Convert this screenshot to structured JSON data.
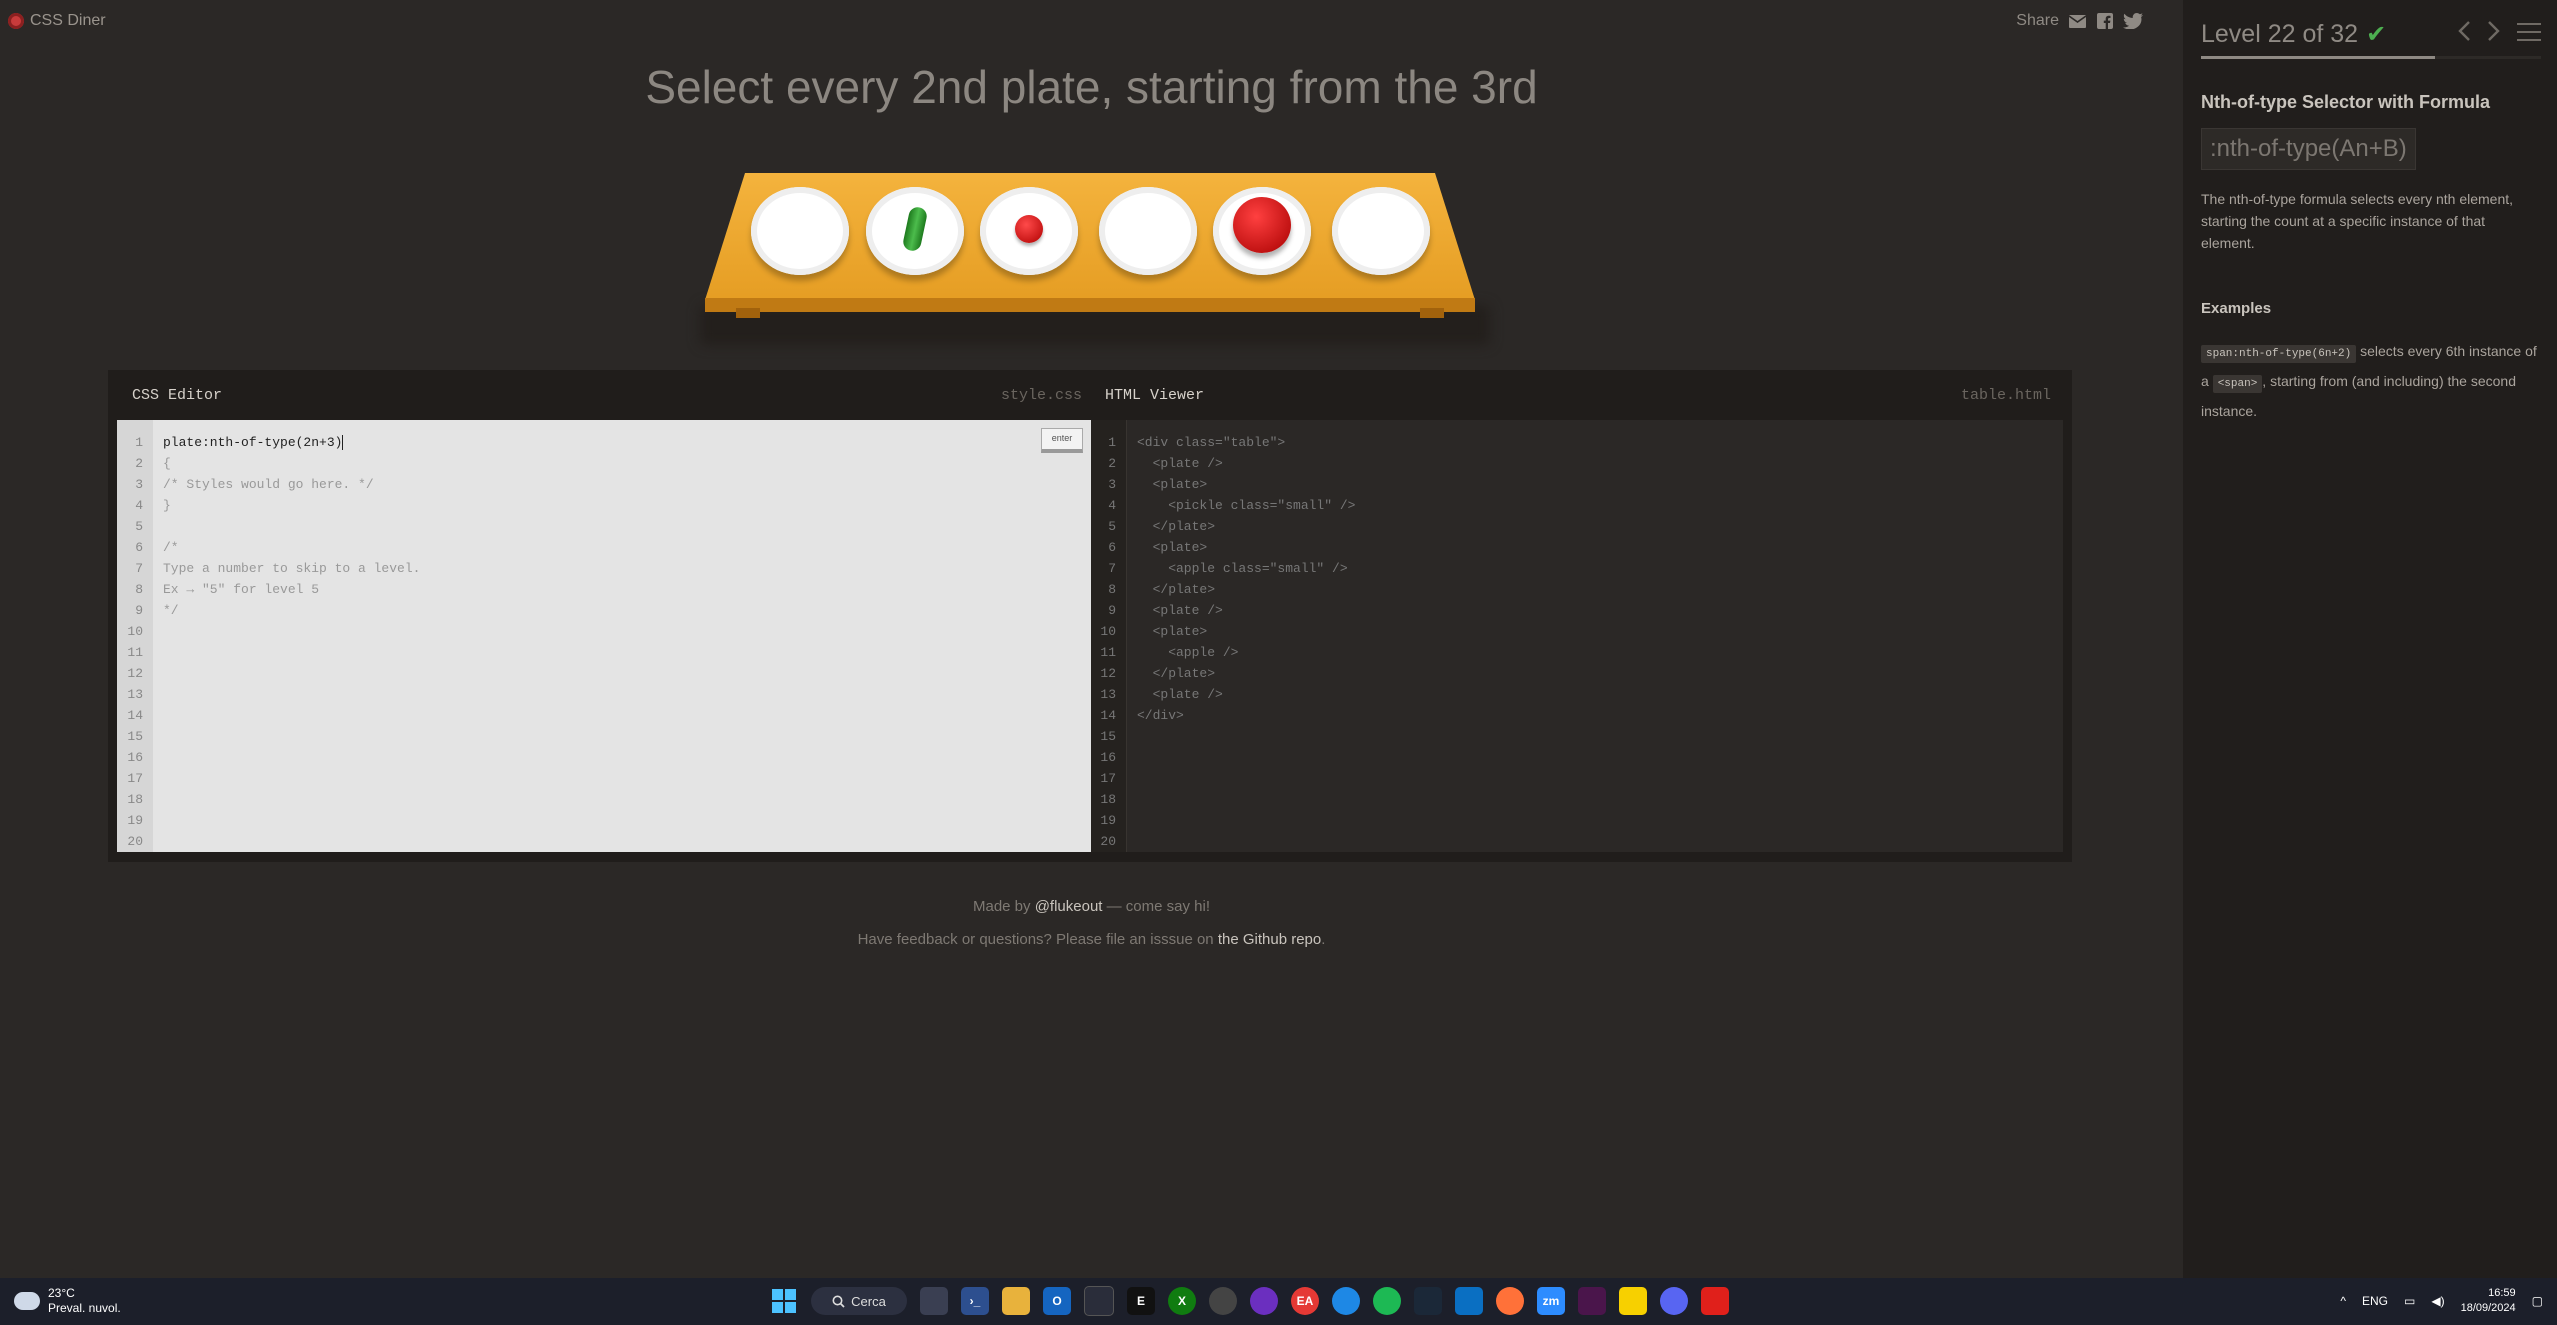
{
  "app": {
    "title": "CSS Diner"
  },
  "share": {
    "label": "Share"
  },
  "instruction": "Select every 2nd plate, starting from the 3rd",
  "css_editor": {
    "header": "CSS Editor",
    "filename": "style.css",
    "enter_label": "enter",
    "input_value": "plate:nth-of-type(2n+3)",
    "lines": [
      "{",
      "/* Styles would go here. */",
      "}",
      "",
      "/*",
      "Type a number to skip to a level.",
      "Ex → \"5\" for level 5",
      "*/"
    ],
    "line_numbers": [
      "1",
      "2",
      "3",
      "4",
      "5",
      "6",
      "7",
      "8",
      "9",
      "10",
      "11",
      "12",
      "13",
      "14",
      "15",
      "16",
      "17",
      "18",
      "19",
      "20"
    ]
  },
  "html_viewer": {
    "header": "HTML Viewer",
    "filename": "table.html",
    "lines": [
      "<div class=\"table\">",
      "  <plate />",
      "  <plate>",
      "    <pickle class=\"small\" />",
      "  </plate>",
      "  <plate>",
      "    <apple class=\"small\" />",
      "  </plate>",
      "  <plate />",
      "  <plate>",
      "    <apple />",
      "  </plate>",
      "  <plate />",
      "</div>"
    ],
    "line_numbers": [
      "1",
      "2",
      "3",
      "4",
      "5",
      "6",
      "7",
      "8",
      "9",
      "10",
      "11",
      "12",
      "13",
      "14",
      "15",
      "16",
      "17",
      "18",
      "19",
      "20"
    ]
  },
  "footer": {
    "line1_pre": "Made by ",
    "line1_link": "@flukeout",
    "line1_post": " — come say hi!",
    "line2_pre": "Have feedback or questions? Please file an isssue on ",
    "line2_link": "the Github repo",
    "line2_post": "."
  },
  "sidebar": {
    "level_text": "Level 22 of 32",
    "level_current": 22,
    "level_total": 32,
    "completed": true,
    "title": "Nth-of-type Selector with Formula",
    "syntax": ":nth-of-type(An+B)",
    "description": "The nth-of-type formula selects every nth element, starting the count at a specific instance of that element.",
    "examples_heading": "Examples",
    "example": {
      "code": "span:nth-of-type(6n+2)",
      "text1": " selects every 6th instance of a ",
      "tag": "<span>",
      "text2": ", starting from (and including) the second instance."
    }
  },
  "taskbar": {
    "weather_temp": "23°C",
    "weather_desc": "Preval. nuvol.",
    "search_label": "Cerca",
    "lang": "ENG",
    "time": "16:59",
    "date": "18/09/2024"
  },
  "colors": {
    "accent_check": "#4caf50",
    "table": "#f0a830",
    "apple": "#d00000",
    "pickle": "#2e8b2e"
  }
}
